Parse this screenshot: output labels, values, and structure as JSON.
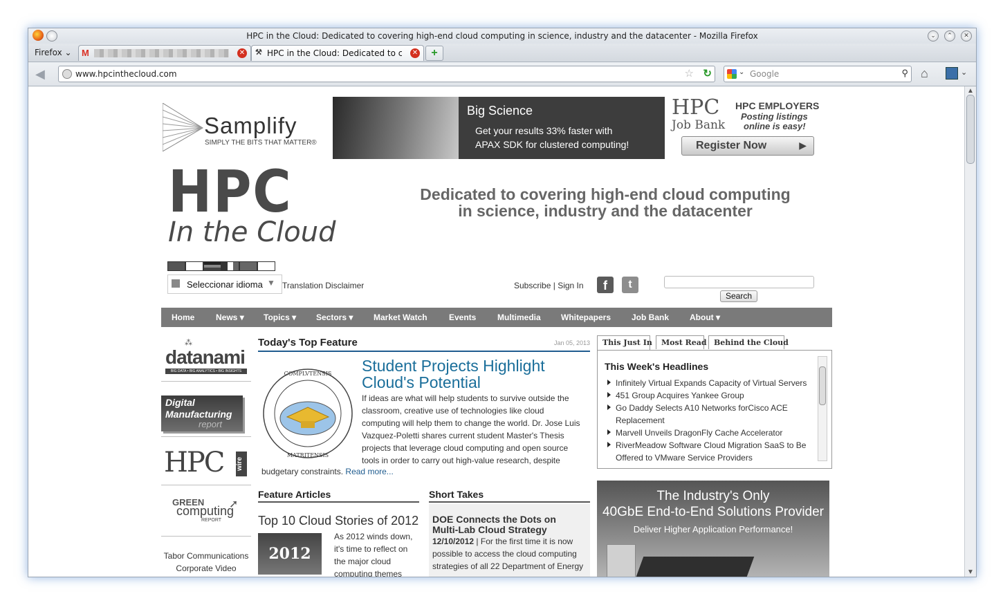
{
  "window": {
    "title": "HPC in the Cloud: Dedicated to covering high-end cloud computing in science, industry and the datacenter - Mozilla Firefox"
  },
  "tabs": {
    "menu_label": "Firefox",
    "items": [
      {
        "label": "",
        "icon": "gmail-icon",
        "active": false
      },
      {
        "label": "HPC in the Cloud: Dedicated to co...",
        "icon": "hpc-favicon-icon",
        "active": true
      }
    ]
  },
  "navbar": {
    "url": "www.hpcinthecloud.com",
    "search_placeholder": "Google"
  },
  "banner": {
    "samplify_name": "Samplify",
    "samplify_tagline": "SIMPLY THE BITS THAT MATTER®",
    "ad_title": "Big Science",
    "ad_text_1": "Get your results 33% faster with",
    "ad_text_2": "APAX SDK for clustered computing!",
    "jobbank_logo_1": "HPC",
    "jobbank_logo_2": "Job Bank",
    "jobbank_title": "HPC EMPLOYERS",
    "jobbank_sub_1": "Posting listings",
    "jobbank_sub_2": "online is easy!",
    "register_label": "Register Now"
  },
  "site": {
    "logo_main": "HPC",
    "logo_sub": "In the Cloud",
    "tagline_1": "Dedicated to covering high-end cloud computing",
    "tagline_2": "in science, industry and the datacenter",
    "language_select": "Seleccionar idioma",
    "translation_disclaimer": "Translation Disclaimer",
    "subscribe": "Subscribe",
    "separator": "|",
    "sign_in": "Sign In",
    "search_button": "Search"
  },
  "nav": [
    "Home",
    "News",
    "Topics",
    "Sectors",
    "Market Watch",
    "Events",
    "Multimedia",
    "Whitepapers",
    "Job Bank",
    "About"
  ],
  "sidebar": {
    "datanami": "datanami",
    "datanami_sub": "BIG DATA • BIG ANALYTICS • BIG INSIGHTS",
    "dmr_1": "Digital",
    "dmr_2": "Manufacturing",
    "dmr_3": "report",
    "hpcwire": "HPC",
    "hpcwire_tag": "wire",
    "green_1": "GREEN",
    "green_2": "computing",
    "green_3": "REPORT",
    "tabor": "Tabor Communications",
    "corporate": "Corporate Video"
  },
  "feature": {
    "heading": "Today's Top Feature",
    "date": "Jan 05, 2013",
    "title_1": "Student Projects Highlight",
    "title_2": "Cloud's Potential",
    "body_1": "If ideas are what will help students to survive outside the",
    "body_2": "classroom, creative use of technologies like cloud",
    "body_3": "computing will help them to change the world. Dr. Jose Luis",
    "body_4": "Vazquez-Poletti shares current student Master's Thesis",
    "body_5": "projects that leverage cloud computing and open source",
    "body_6": "tools in order to carry out high-value research, despite",
    "body_7": "budgetary constraints.",
    "read_more": "Read more..."
  },
  "feature_articles": {
    "heading": "Feature Articles",
    "title": "Top 10 Cloud Stories of 2012",
    "thumb": "2012",
    "text_1": "As 2012 winds down,",
    "text_2": "it's time to reflect on",
    "text_3": "the major cloud",
    "text_4": "computing themes"
  },
  "short_takes": {
    "heading": "Short Takes",
    "title_1": "DOE Connects the Dots on",
    "title_2": "Multi-Lab Cloud Strategy",
    "date": "12/10/2012",
    "text_1": "| For the first time it is now",
    "text_2": "possible to access the cloud computing",
    "text_3": "strategies of all 22 Department of Energy"
  },
  "headlines": {
    "tabs": [
      "This Just In",
      "Most Read",
      "Behind the Cloud"
    ],
    "heading": "This Week's Headlines",
    "items": [
      "Infinitely Virtual Expands Capacity of Virtual Servers",
      "451 Group Acquires Yankee Group",
      "Go Daddy Selects A10 Networks forCisco ACE",
      "Replacement",
      "Marvell Unveils DragonFly Cache Accelerator",
      "RiverMeadow Software Cloud Migration SaaS to Be",
      "Offered to VMware Service Providers"
    ]
  },
  "side_ad": {
    "line_1": "The Industry's Only",
    "line_2": "40GbE End-to-End Solutions Provider",
    "line_3": "Deliver Higher Application Performance!"
  },
  "colors": {
    "nav_bg": "#7a7a7a",
    "link_blue": "#1f5c8f",
    "feature_title": "#1a6e9a"
  }
}
